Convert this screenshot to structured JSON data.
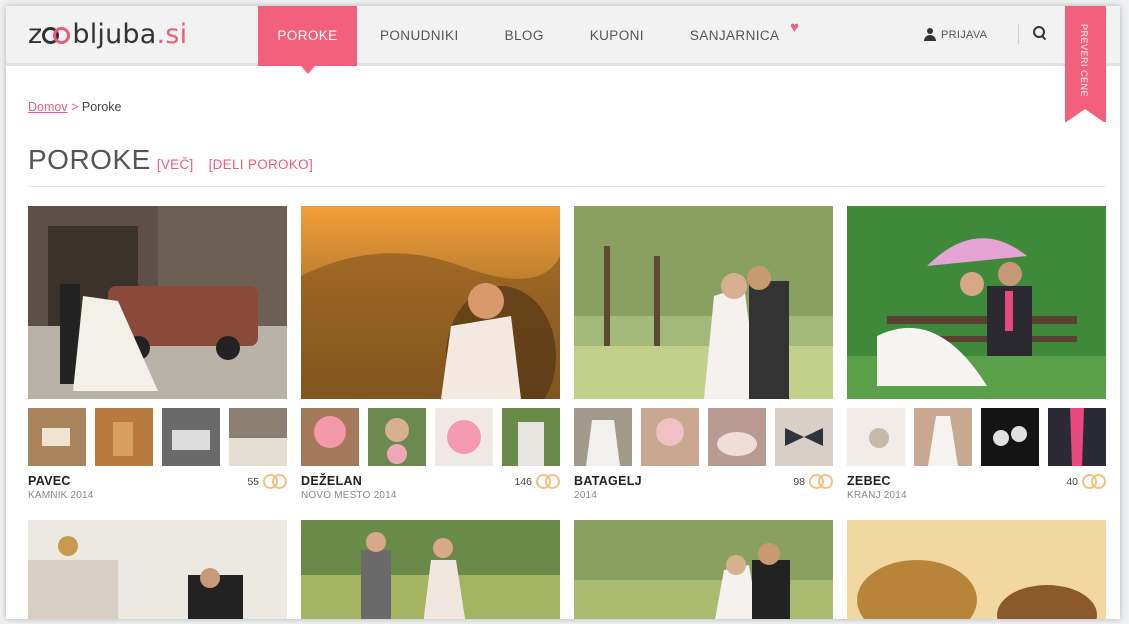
{
  "header": {
    "logo_prefix": "z",
    "logo_suffix": "bljuba",
    "logo_tld": ".si",
    "nav": [
      "POROKE",
      "PONUDNIKI",
      "BLOG",
      "KUPONI",
      "SANJARNICA"
    ],
    "login_label": "PRIJAVA",
    "ribbon_label": "PREVERI CENE"
  },
  "breadcrumb": {
    "home": "Domov",
    "separator": ">",
    "current": "Poroke"
  },
  "title": {
    "text": "POROKE",
    "link_more": "[VEČ]",
    "link_share": "[DELI POROKO]"
  },
  "weddings": [
    {
      "name": "PAVEC",
      "subtitle": "KAMNIK 2014",
      "count": "55"
    },
    {
      "name": "DEŽELAN",
      "subtitle": "NOVO MESTO 2014",
      "count": "146"
    },
    {
      "name": "BATAGELJ",
      "subtitle": "2014",
      "count": "98"
    },
    {
      "name": "ZEBEC",
      "subtitle": "KRANJ 2014",
      "count": "40"
    }
  ],
  "colors": {
    "accent": "#f3607c",
    "rings": "#f2c07a"
  },
  "icons": [
    "user-icon",
    "search-icon",
    "heart-icon",
    "rings-icon"
  ]
}
